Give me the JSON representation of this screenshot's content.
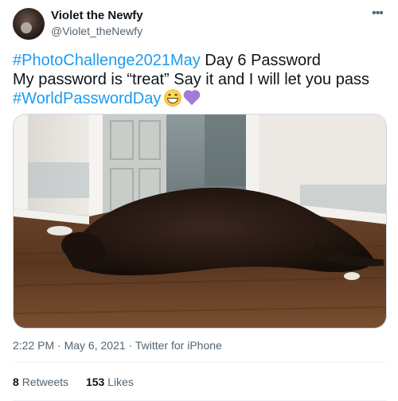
{
  "author": {
    "display_name": "Violet the Newfy",
    "handle": "@Violet_theNewfy"
  },
  "more_label": "•••",
  "tweet": {
    "line1_hashtag": "#PhotoChallenge2021May",
    "line1_rest": " Day 6 Password",
    "line2": "My password is “treat” Say it and I will let you pass",
    "line3_hashtag": "#WorldPasswordDay",
    "emojis": [
      "grinning-face-emoji",
      "purple-heart-emoji"
    ]
  },
  "media": {
    "icon": "dog-photo"
  },
  "meta": {
    "time": "2:22 PM",
    "separator": " · ",
    "date": "May 6, 2021",
    "source": "Twitter for iPhone"
  },
  "stats": {
    "retweets_count": "8",
    "retweets_label": "Retweets",
    "likes_count": "153",
    "likes_label": "Likes"
  },
  "colors": {
    "link": "#1d9bf0",
    "text": "#0f1419",
    "secondary": "#536471",
    "divider": "#eff3f4"
  }
}
